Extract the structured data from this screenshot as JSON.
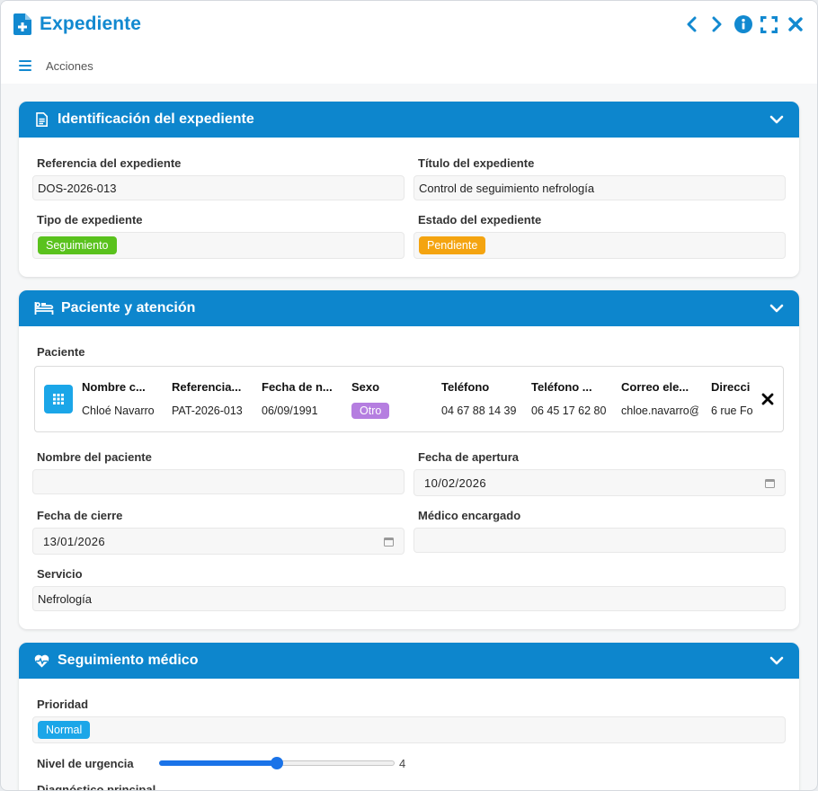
{
  "window": {
    "title": "Expediente",
    "menu_label": "Acciones"
  },
  "colors": {
    "accent": "#0d86cd",
    "title": "#1289d0"
  },
  "sections": {
    "identificacion": {
      "title": "Identificación del expediente",
      "icon": "document-icon",
      "ref_label": "Referencia del expediente",
      "ref_value": "DOS-2026-013",
      "titulo_label": "Título del expediente",
      "titulo_value": "Control de seguimiento nefrología",
      "tipo_label": "Tipo de expediente",
      "tipo_value": "Seguimiento",
      "tipo_color": "#5ac21d",
      "estado_label": "Estado del expediente",
      "estado_value": "Pendiente",
      "estado_color": "#f4a410"
    },
    "paciente": {
      "title": "Paciente y atención",
      "icon": "hospital-bed-icon",
      "paciente_label": "Paciente",
      "columns": [
        "Nombre c...",
        "Referencia...",
        "Fecha de n...",
        "Sexo",
        "Teléfono",
        "Teléfono ...",
        "Correo ele...",
        "Direcci"
      ],
      "row": {
        "nombre": "Chloé Navarro",
        "referencia": "PAT-2026-013",
        "fecha_nac": "06/09/1991",
        "sexo": "Otro",
        "sexo_color": "#b57ee0",
        "telefono": "04 67 88 14 39",
        "telefono2": "06 45 17 62 80",
        "correo": "chloe.navarro@",
        "direccion": "6 rue Fo"
      },
      "nombre_label": "Nombre del paciente",
      "nombre_value": "",
      "apertura_label": "Fecha de apertura",
      "apertura_value": "10/02/2026",
      "cierre_label": "Fecha de cierre",
      "cierre_value": "13/01/2026",
      "medico_label": "Médico encargado",
      "medico_value": "",
      "servicio_label": "Servicio",
      "servicio_value": "Nefrología"
    },
    "seguimiento": {
      "title": "Seguimiento médico",
      "icon": "heart-pulse-icon",
      "prioridad_label": "Prioridad",
      "prioridad_value": "Normal",
      "prioridad_color": "#1ba6e8",
      "urgencia_label": "Nivel de urgencia",
      "urgencia_value": "4",
      "urgencia_fraction": 0.5,
      "diagnostico_label": "Diagnóstico principal"
    }
  }
}
